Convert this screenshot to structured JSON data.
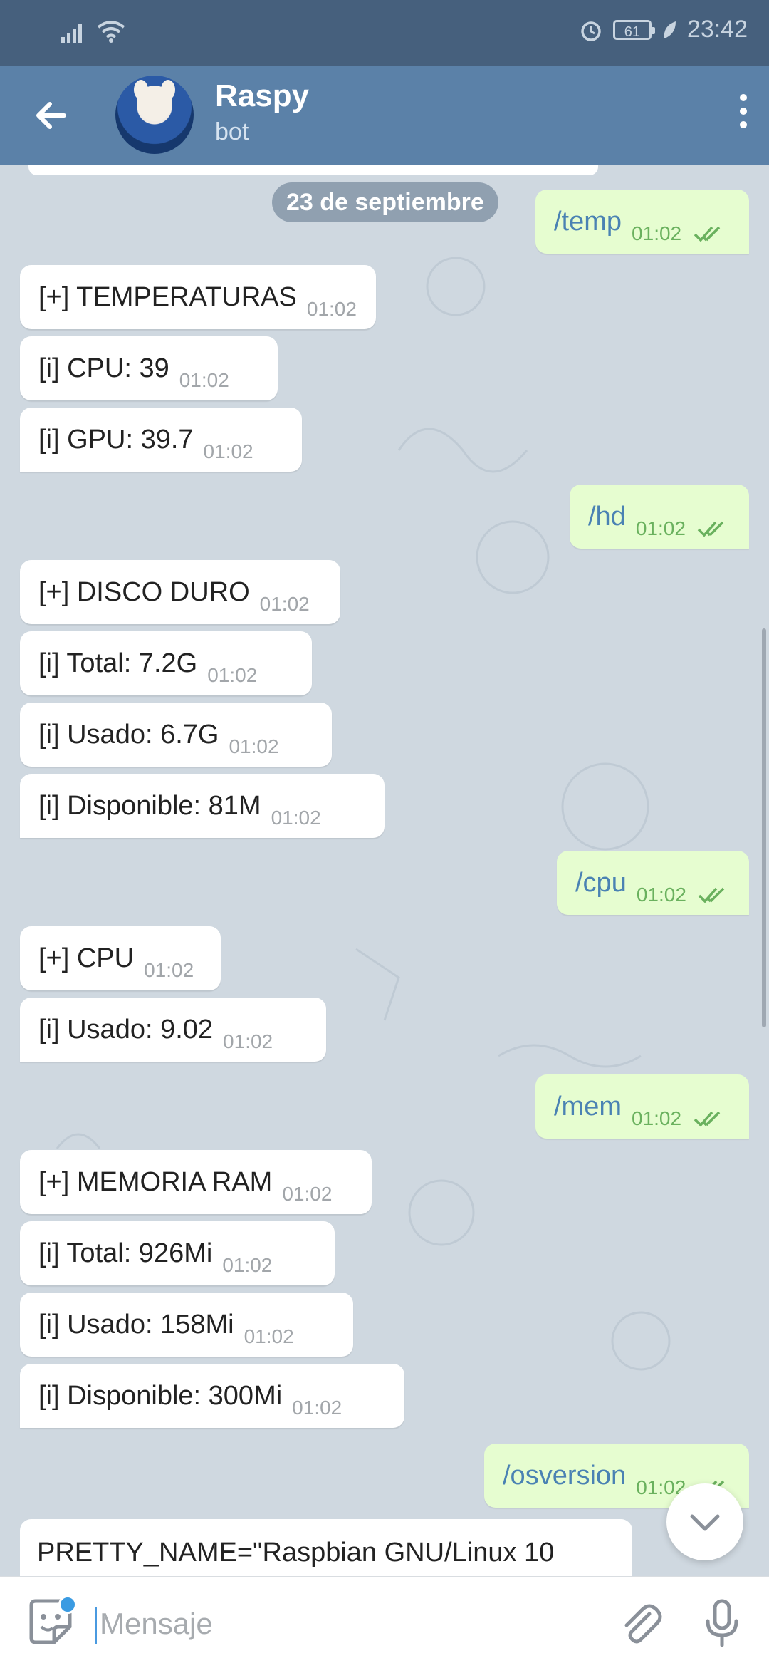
{
  "statusbar": {
    "battery": "61",
    "time": "23:42"
  },
  "header": {
    "title": "Raspy",
    "subtitle": "bot"
  },
  "chat": {
    "date": "23 de septiembre",
    "messages": [
      {
        "dir": "out",
        "text": "/temp",
        "time": "01:02"
      },
      {
        "dir": "in",
        "text": "[+] TEMPERATURAS",
        "time": "01:02"
      },
      {
        "dir": "in",
        "text": "[i]   CPU: 39",
        "time": "01:02"
      },
      {
        "dir": "in",
        "text": "[i]   GPU: 39.7",
        "time": "01:02"
      },
      {
        "dir": "out",
        "text": "/hd",
        "time": "01:02"
      },
      {
        "dir": "in",
        "text": "[+] DISCO DURO",
        "time": "01:02"
      },
      {
        "dir": "in",
        "text": "[i]   Total: 7.2G",
        "time": "01:02"
      },
      {
        "dir": "in",
        "text": "[i]   Usado: 6.7G",
        "time": "01:02"
      },
      {
        "dir": "in",
        "text": "[i]   Disponible: 81M",
        "time": "01:02"
      },
      {
        "dir": "out",
        "text": "/cpu",
        "time": "01:02"
      },
      {
        "dir": "in",
        "text": "[+] CPU",
        "time": "01:02"
      },
      {
        "dir": "in",
        "text": "[i]   Usado: 9.02",
        "time": "01:02"
      },
      {
        "dir": "out",
        "text": "/mem",
        "time": "01:02"
      },
      {
        "dir": "in",
        "text": "[+] MEMORIA RAM",
        "time": "01:02"
      },
      {
        "dir": "in",
        "text": "[i]   Total: 926Mi",
        "time": "01:02"
      },
      {
        "dir": "in",
        "text": "[i]   Usado: 158Mi",
        "time": "01:02"
      },
      {
        "dir": "in",
        "text": "[i]   Disponible: 300Mi",
        "time": "01:02"
      },
      {
        "dir": "out",
        "text": "/osversion",
        "time": "01:02"
      }
    ],
    "last_message": "PRETTY_NAME=\"Raspbian GNU/Linux 10"
  },
  "input": {
    "placeholder": "Mensaje"
  },
  "colors": {
    "header": "#5b81a8",
    "statusbar": "#46607d",
    "outgoing_bubble": "#e6fdd0",
    "accent": "#3a9be2"
  },
  "icons": [
    "back-arrow-icon",
    "more-vert-icon",
    "double-check-icon",
    "sticker-icon",
    "attach-icon",
    "mic-icon",
    "chevron-down-icon"
  ]
}
